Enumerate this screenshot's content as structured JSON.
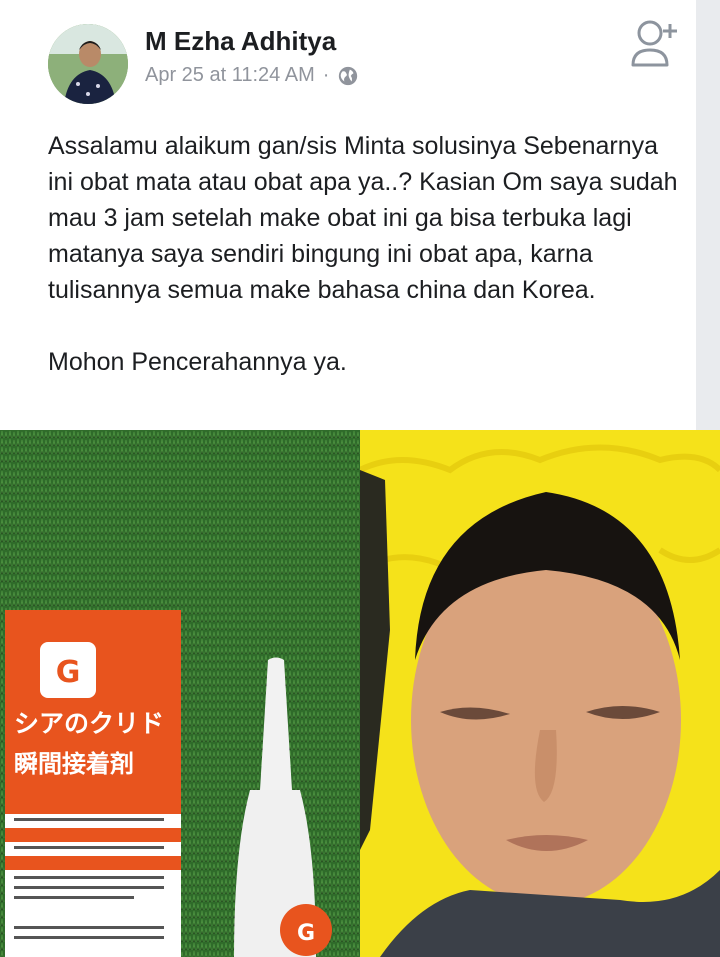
{
  "post": {
    "author": "M Ezha Adhitya",
    "timestamp": "Apr 25 at 11:24 AM",
    "separator": "·",
    "privacy_icon": "globe-icon",
    "action_icon": "add-friend-icon",
    "text_paragraph_1": "Assalamu alaikum gan/sis Minta solusinya Sebenarnya ini obat mata atau obat apa ya..? Kasian Om saya sudah mau 3 jam setelah make obat ini ga bisa terbuka lagi matanya saya sendiri bingung ini obat apa, karna tulisannya semua make bahasa china dan Korea.",
    "text_paragraph_2": "Mohon Pencerahannya ya."
  },
  "photos": {
    "left": {
      "brand_mark": "G",
      "product_name": "シアのクリド",
      "product_subtitle": "瞬間接着剤",
      "cap_label": "シアのクリド"
    },
    "right": {}
  },
  "colors": {
    "meta_gray": "#90949c",
    "text": "#1c1e21",
    "tube_orange": "#e8541e",
    "grass": "#2f6b2a",
    "yellow_bg": "#f5e21a"
  }
}
